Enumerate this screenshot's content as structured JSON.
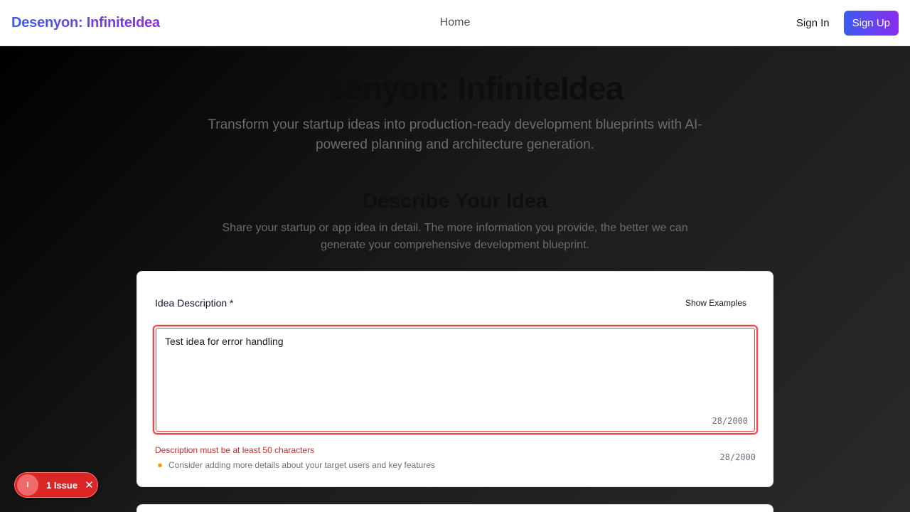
{
  "navbar": {
    "brand": "Desenyon: InfiniteIdea",
    "links": [
      {
        "label": "Home"
      }
    ],
    "signin_label": "Sign In",
    "signup_label": "Sign Up"
  },
  "hero": {
    "title": "Desenyon: InfiniteIdea",
    "subtitle": "Transform your startup ideas into production-ready development blueprints with AI-powered planning and architecture generation."
  },
  "section": {
    "title": "Describe Your Idea",
    "subtitle": "Share your startup or app idea in detail. The more information you provide, the better we can generate your comprehensive development blueprint."
  },
  "form": {
    "label": "Idea Description *",
    "examples_label": "Show Examples",
    "value": "Test idea for error handling",
    "char_count": "28/2000",
    "error": "Description must be at least 50 characters",
    "hint": "Consider adding more details about your target users and key features",
    "hint_icon": "lightbulb-icon"
  },
  "issues": {
    "avatar_letter": "I",
    "label": "1 Issue",
    "close_icon": "close-icon"
  },
  "colors": {
    "brand_start": "#3b5bf0",
    "brand_end": "#8b2cf0",
    "error": "#ef4444"
  }
}
